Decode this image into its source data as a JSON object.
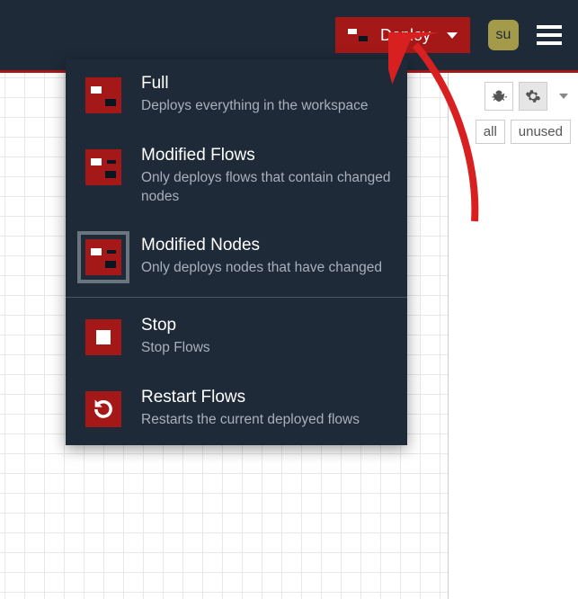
{
  "header": {
    "deploy_label": "Deploy",
    "avatar_text": "su"
  },
  "deploy_menu": {
    "items": [
      {
        "title": "Full",
        "desc": "Deploys everything in the workspace"
      },
      {
        "title": "Modified Flows",
        "desc": "Only deploys flows that contain changed nodes"
      },
      {
        "title": "Modified Nodes",
        "desc": "Only deploys nodes that have changed"
      }
    ],
    "actions": [
      {
        "title": "Stop",
        "desc": "Stop Flows"
      },
      {
        "title": "Restart Flows",
        "desc": "Restarts the current deployed flows"
      }
    ],
    "selected_index": 2
  },
  "sidebar": {
    "filters": {
      "all": "all",
      "unused": "unused"
    }
  }
}
